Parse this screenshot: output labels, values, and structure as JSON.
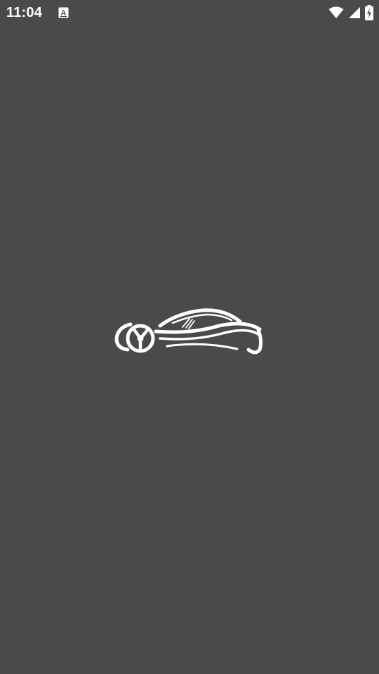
{
  "status_bar": {
    "time": "11:04",
    "notification_icon": "font-a-icon",
    "icons": [
      "wifi-icon",
      "cell-signal-icon",
      "battery-charging-icon"
    ]
  },
  "splash": {
    "logo_icon": "sports-car-logo-icon",
    "background_color": "#4a4a4a",
    "logo_color": "#ffffff"
  }
}
